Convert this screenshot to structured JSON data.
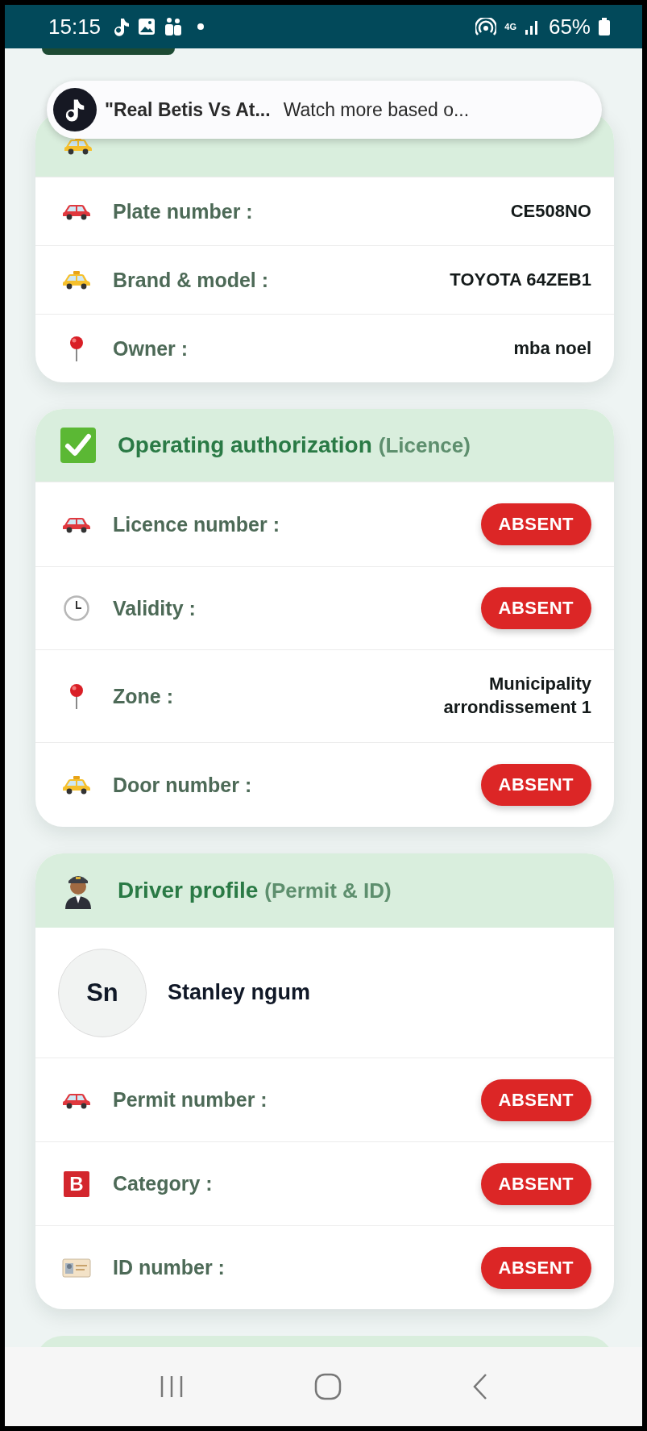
{
  "status_bar": {
    "time": "15:15",
    "network": "4G",
    "battery": "65%"
  },
  "notification": {
    "title": "\"Real Betis Vs At...",
    "text": "Watch more based o..."
  },
  "sections": [
    {
      "rows": [
        {
          "label": "Plate number :",
          "kind": "text",
          "value": "CE508NO"
        },
        {
          "label": "Brand & model :",
          "kind": "text",
          "value": "TOYOTA 64ZEB1"
        },
        {
          "label": "Owner :",
          "kind": "text",
          "value": "mba noel"
        }
      ]
    },
    {
      "title": "Operating authorization",
      "subtitle": "(Licence)",
      "rows": [
        {
          "label": "Licence number :",
          "kind": "badge",
          "value": "ABSENT"
        },
        {
          "label": "Validity :",
          "kind": "badge",
          "value": "ABSENT"
        },
        {
          "label": "Zone :",
          "kind": "text",
          "value": "Municipality arrondissement 1"
        },
        {
          "label": "Door number :",
          "kind": "badge",
          "value": "ABSENT"
        }
      ]
    },
    {
      "title": "Driver profile",
      "subtitle": "(Permit & ID)",
      "profile": {
        "initials": "Sn",
        "name": "Stanley ngum"
      },
      "rows": [
        {
          "label": "Permit number :",
          "kind": "badge",
          "value": "ABSENT"
        },
        {
          "label": "Category :",
          "kind": "badge",
          "value": "ABSENT",
          "icon_letter": "B"
        },
        {
          "label": "ID number :",
          "kind": "badge",
          "value": "ABSENT"
        }
      ]
    }
  ]
}
